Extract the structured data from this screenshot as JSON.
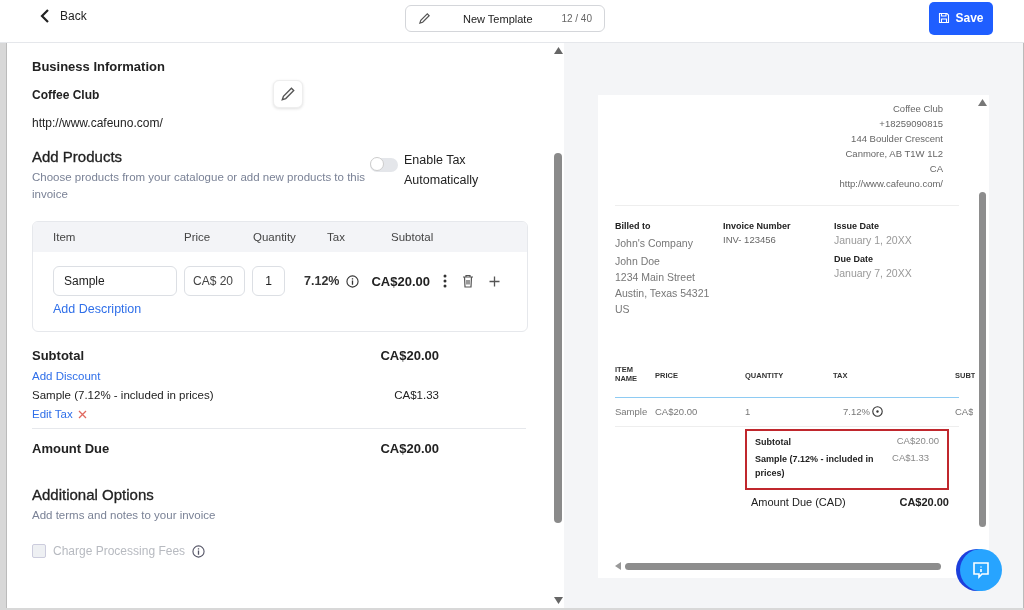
{
  "header": {
    "back_label": "Back",
    "template_name": "New Template",
    "char_count": "12 / 40",
    "save_label": "Save"
  },
  "business": {
    "heading": "Business Information",
    "name": "Coffee Club",
    "website": "http://www.cafeuno.com/"
  },
  "products": {
    "heading": "Add Products",
    "description": "Choose products from your catalogue or add new products to this invoice",
    "tax_toggle": {
      "label": "Enable Tax Automatically",
      "on": false
    },
    "columns": [
      "Item",
      "Price",
      "Quantity",
      "Tax",
      "Subtotal"
    ],
    "rows": [
      {
        "item": "Sample",
        "price": "CA$ 20",
        "quantity": "1",
        "tax": "7.12%",
        "subtotal": "CA$20.00",
        "add_description": "Add Description"
      }
    ]
  },
  "totals": {
    "subtotal_label": "Subtotal",
    "subtotal_value": "CA$20.00",
    "add_discount": "Add Discount",
    "tax_label": "Sample (7.12% - included in prices)",
    "tax_value": "CA$1.33",
    "edit_tax": "Edit Tax",
    "amount_due_label": "Amount Due",
    "amount_due_value": "CA$20.00"
  },
  "additional": {
    "heading": "Additional Options",
    "description": "Add terms and notes to your invoice",
    "charge_fees": {
      "label": "Charge Processing Fees",
      "checked": false,
      "disabled": true
    }
  },
  "preview": {
    "business_lines": [
      "Coffee Club",
      "+18259090815",
      "144 Boulder Crescent",
      "Canmore, AB T1W 1L2",
      "CA",
      "http://www.cafeuno.com/"
    ],
    "billed_to": {
      "label": "Billed to",
      "lines": [
        "John's Company",
        "John Doe",
        "1234 Main Street",
        "Austin, Texas 54321",
        "US"
      ]
    },
    "invoice_number": {
      "label": "Invoice Number",
      "value": "INV- 123456"
    },
    "issue_date": {
      "label": "Issue Date",
      "value": "January 1, 20XX"
    },
    "due_date": {
      "label": "Due Date",
      "value": "January 7, 20XX"
    },
    "columns": [
      "ITEM NAME",
      "PRICE",
      "QUANTITY",
      "TAX",
      "SUBT"
    ],
    "rows": [
      [
        "Sample",
        "CA$20.00",
        "1",
        "7.12%",
        "CA$"
      ]
    ],
    "subtotal_label": "Subtotal",
    "subtotal_value": "CA$20.00",
    "tax_label": "Sample (7.12% - included in prices)",
    "tax_value": "CA$1.33",
    "amount_due_label": "Amount Due (CAD)",
    "amount_due_value": "CA$20.00"
  }
}
